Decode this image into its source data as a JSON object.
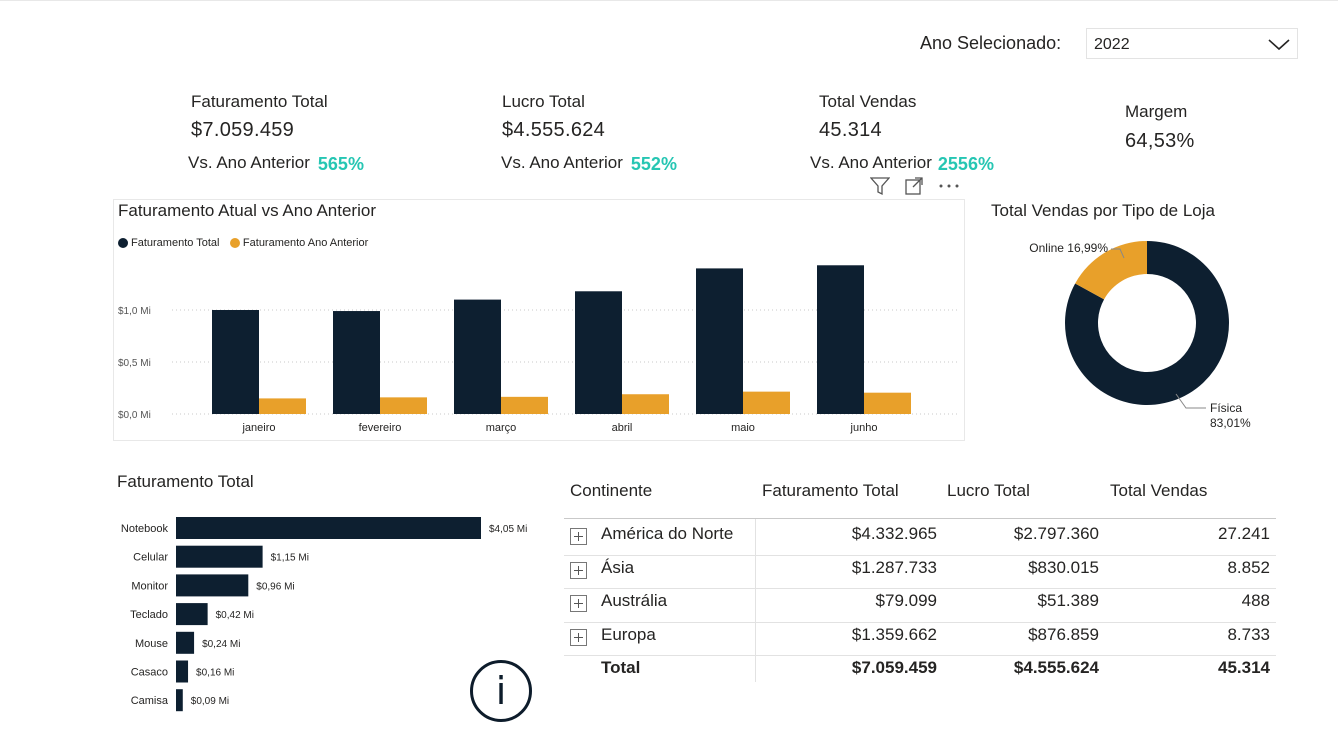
{
  "filter": {
    "label": "Ano Selecionado:",
    "value": "2022"
  },
  "kpis": {
    "faturamento": {
      "title": "Faturamento Total",
      "value": "$7.059.459",
      "sub": "Vs. Ano Anterior",
      "pct": "565%"
    },
    "lucro": {
      "title": "Lucro Total",
      "value": "$4.555.624",
      "sub": "Vs. Ano Anterior",
      "pct": "552%"
    },
    "vendas": {
      "title": "Total Vendas",
      "value": "45.314",
      "sub": "Vs. Ano Anterior",
      "pct": "2556%"
    },
    "margem": {
      "title": "Margem",
      "value": "64,53%"
    }
  },
  "colors": {
    "navy": "#0d1f30",
    "orange": "#e8a02a",
    "teal": "#26c6b3"
  },
  "header_icons": [
    "filter-icon",
    "focus-mode-icon",
    "more-options-icon"
  ],
  "chart_data": [
    {
      "type": "bar",
      "title": "Faturamento Atual vs Ano Anterior",
      "categories": [
        "janeiro",
        "fevereiro",
        "março",
        "abril",
        "maio",
        "junho"
      ],
      "series": [
        {
          "name": "Faturamento Total",
          "color": "#0d1f30",
          "values": [
            1.0,
            0.99,
            1.1,
            1.18,
            1.4,
            1.43
          ]
        },
        {
          "name": "Faturamento Ano Anterior",
          "color": "#e8a02a",
          "values": [
            0.15,
            0.16,
            0.165,
            0.19,
            0.215,
            0.205
          ]
        }
      ],
      "yticks": [
        "$0,0 Mi",
        "$0,5 Mi",
        "$1,0 Mi"
      ],
      "ylim": [
        0,
        1.6
      ],
      "legend": "top-left",
      "grid": true
    },
    {
      "type": "pie",
      "title": "Total Vendas por Tipo de Loja",
      "labels": [
        "Física",
        "Online"
      ],
      "values": [
        83.01,
        16.99
      ],
      "label_text": [
        "Física\n83,01%",
        "Online 16,99%"
      ],
      "colors": [
        "#0d1f30",
        "#e8a02a"
      ],
      "donut": true
    },
    {
      "type": "bar",
      "orientation": "horizontal",
      "title": "Faturamento Total",
      "categories": [
        "Notebook",
        "Celular",
        "Monitor",
        "Teclado",
        "Mouse",
        "Casaco",
        "Camisa"
      ],
      "values": [
        4.05,
        1.15,
        0.96,
        0.42,
        0.24,
        0.16,
        0.09
      ],
      "data_labels": [
        "$4,05 Mi",
        "$1,15 Mi",
        "$0,96 Mi",
        "$0,42 Mi",
        "$0,24 Mi",
        "$0,16 Mi",
        "$0,09 Mi"
      ],
      "color": "#0d1f30"
    }
  ],
  "table": {
    "headers": [
      "Continente",
      "Faturamento Total",
      "Lucro Total",
      "Total Vendas"
    ],
    "rows": [
      [
        "América do Norte",
        "$4.332.965",
        "$2.797.360",
        "27.241"
      ],
      [
        "Ásia",
        "$1.287.733",
        "$830.015",
        "8.852"
      ],
      [
        "Austrália",
        "$79.099",
        "$51.389",
        "488"
      ],
      [
        "Europa",
        "$1.359.662",
        "$876.859",
        "8.733"
      ]
    ],
    "total": [
      "Total",
      "$7.059.459",
      "$4.555.624",
      "45.314"
    ]
  },
  "info_icon": "info-icon"
}
